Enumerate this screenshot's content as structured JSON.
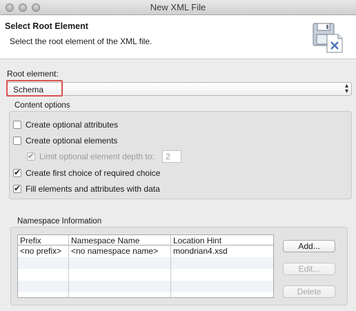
{
  "window": {
    "title": "New XML File"
  },
  "banner": {
    "title": "Select Root Element",
    "description": "Select the root element of the XML file."
  },
  "root": {
    "label": "Root element:",
    "selected": "Schema"
  },
  "content_options": {
    "label": "Content options",
    "items": [
      {
        "label": "Create optional attributes",
        "checked": false,
        "enabled": true
      },
      {
        "label": "Create optional elements",
        "checked": false,
        "enabled": true
      },
      {
        "label": "Limit optional element depth to:",
        "checked": true,
        "enabled": false
      },
      {
        "label": "Create first choice of required choice",
        "checked": true,
        "enabled": true
      },
      {
        "label": "Fill elements and attributes with data",
        "checked": true,
        "enabled": true
      }
    ],
    "depth_value": "2"
  },
  "namespace": {
    "label": "Namespace Information",
    "columns": [
      "Prefix",
      "Namespace Name",
      "Location Hint"
    ],
    "rows": [
      [
        "<no prefix>",
        "<no namespace name>",
        "mondrian4.xsd"
      ]
    ],
    "buttons": {
      "add": "Add...",
      "edit": "Edit...",
      "delete": "Delete"
    }
  },
  "icons": {
    "traffic": [
      "close-icon",
      "minimize-icon",
      "zoom-icon"
    ],
    "banner": "xml-wizard-icon"
  }
}
